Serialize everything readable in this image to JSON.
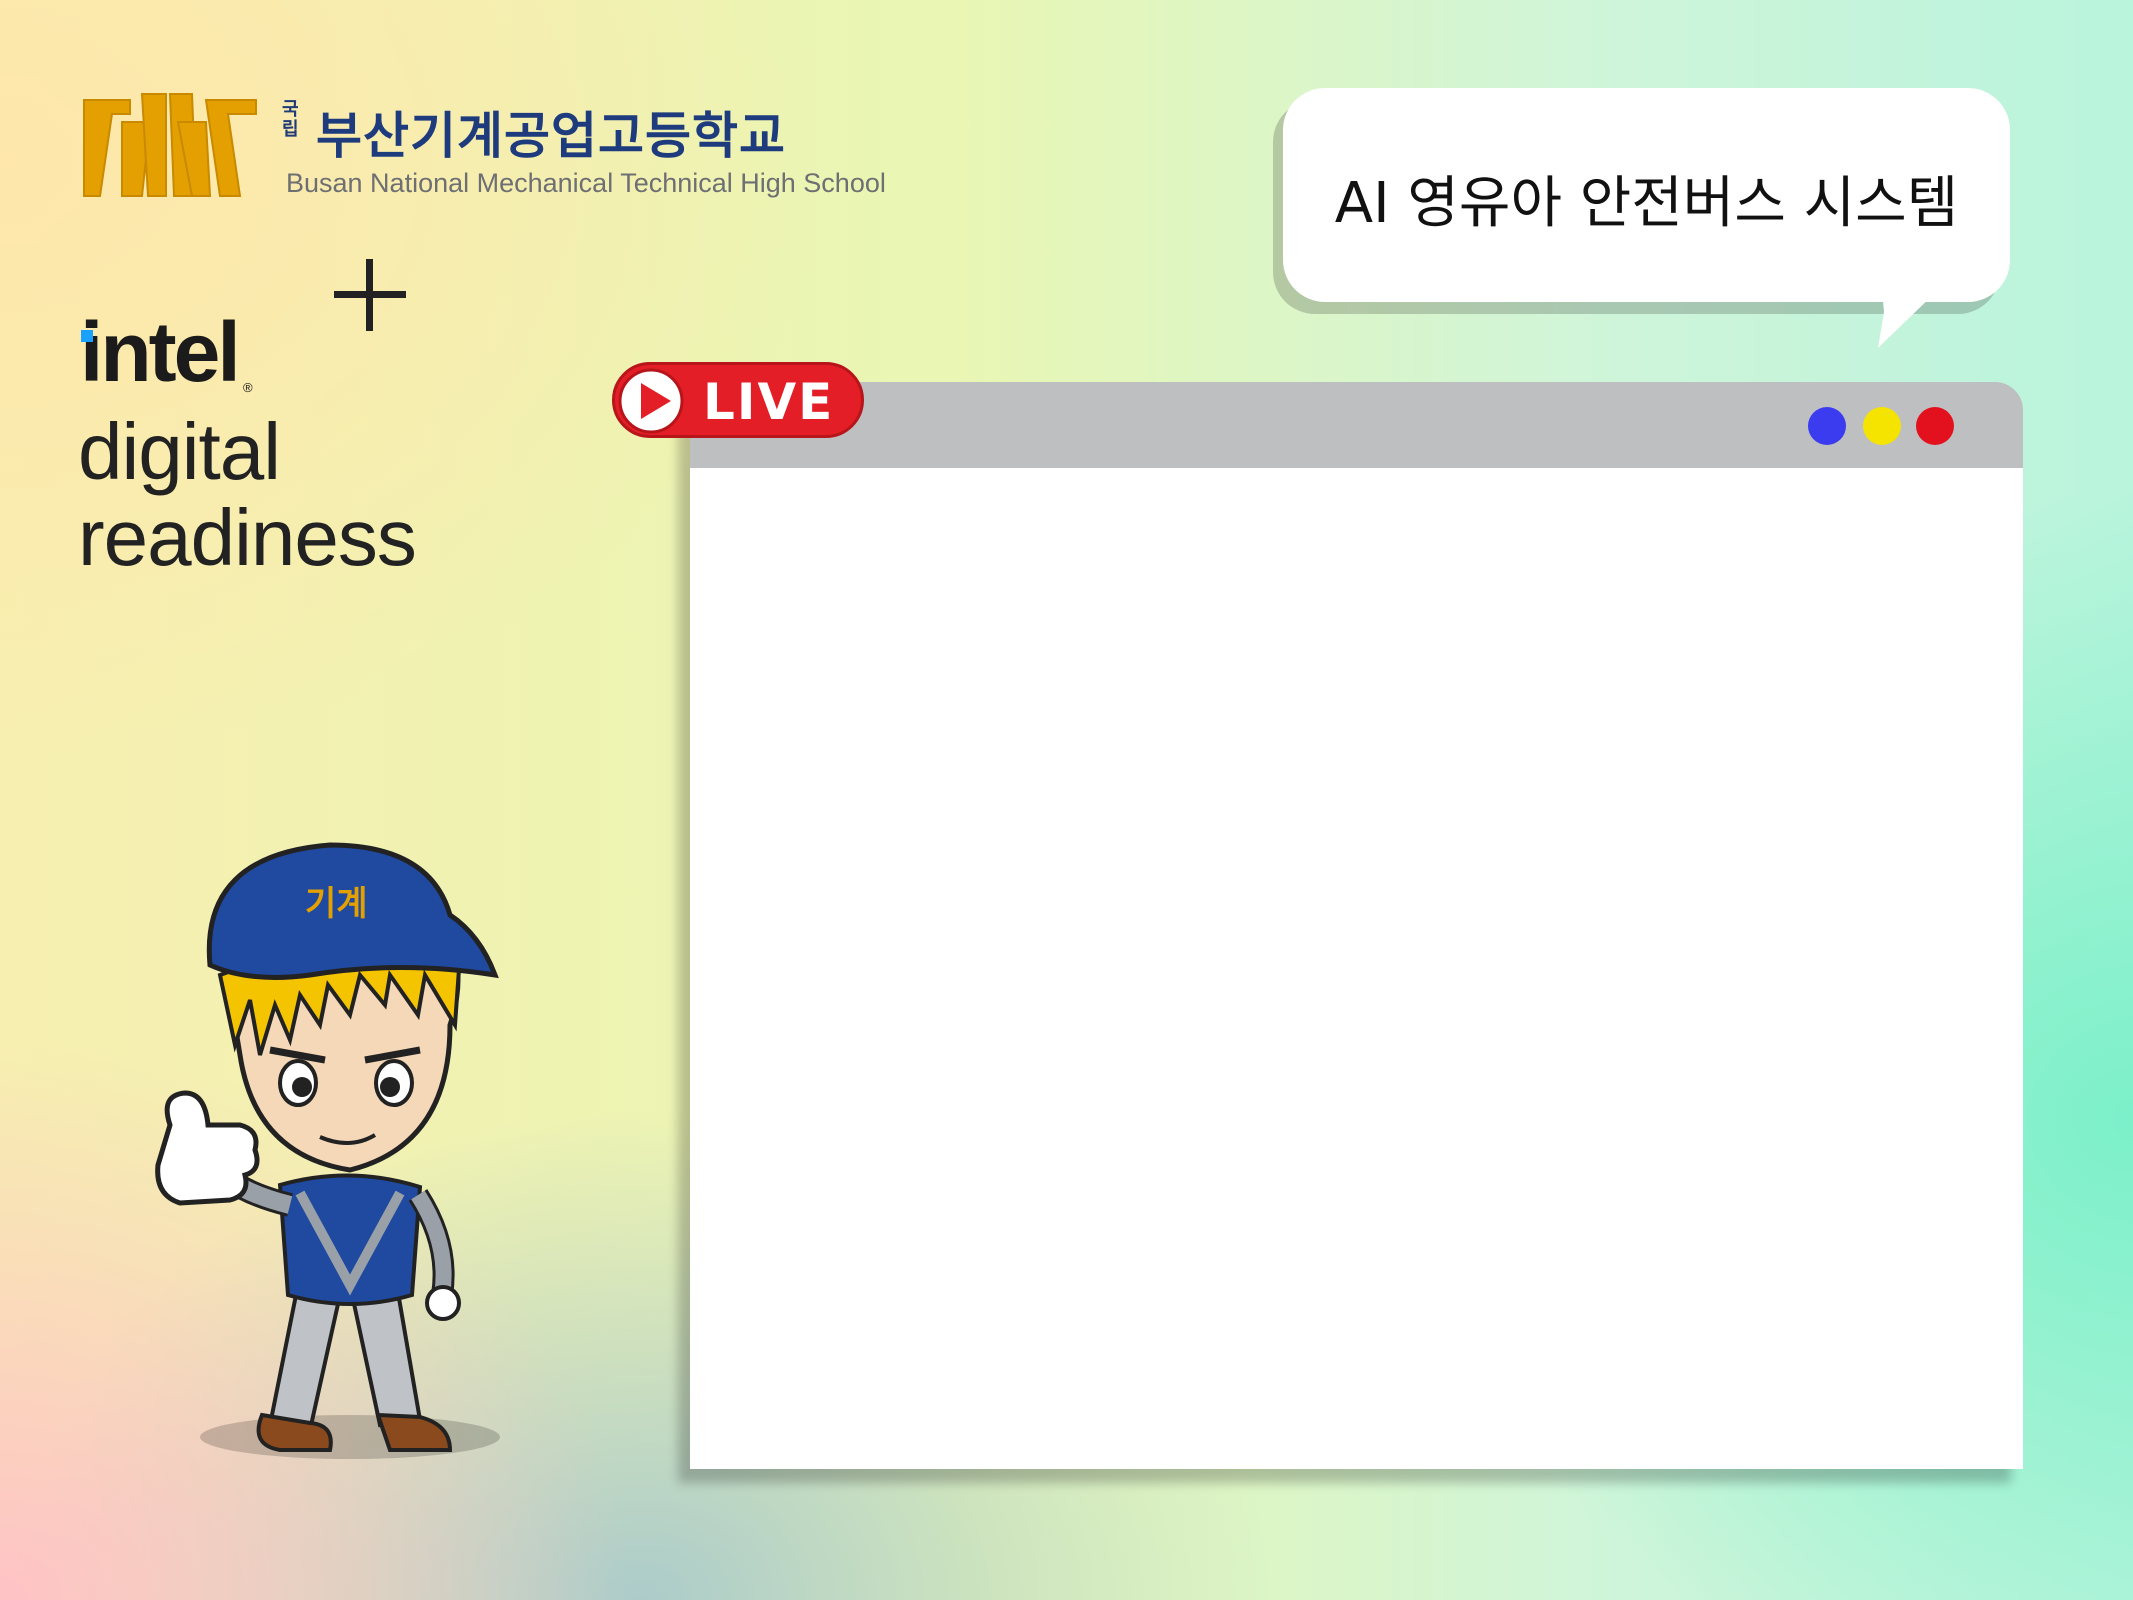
{
  "school": {
    "prefix": "국립",
    "name_ko": "부산기계공업고등학교",
    "name_en": "Busan National Mechanical Technical High School",
    "logo_icon": "school-emblem",
    "brand_color": "#e3a000"
  },
  "partner": {
    "plus_icon": "plus-icon",
    "wordmark": "intel",
    "line1": "digital",
    "line2": "readiness",
    "accent": "#1aa0ff"
  },
  "bubble": {
    "title": "AI 영유아 안전버스 시스템"
  },
  "live_badge": {
    "label": "LIVE",
    "color": "#e41e26"
  },
  "browser": {
    "window_controls": [
      "blue-dot",
      "yellow-dot",
      "red-dot"
    ],
    "control_colors": [
      "#3b3bf0",
      "#f5e400",
      "#e3101e"
    ]
  },
  "mascot": {
    "icon": "mascot-character"
  }
}
